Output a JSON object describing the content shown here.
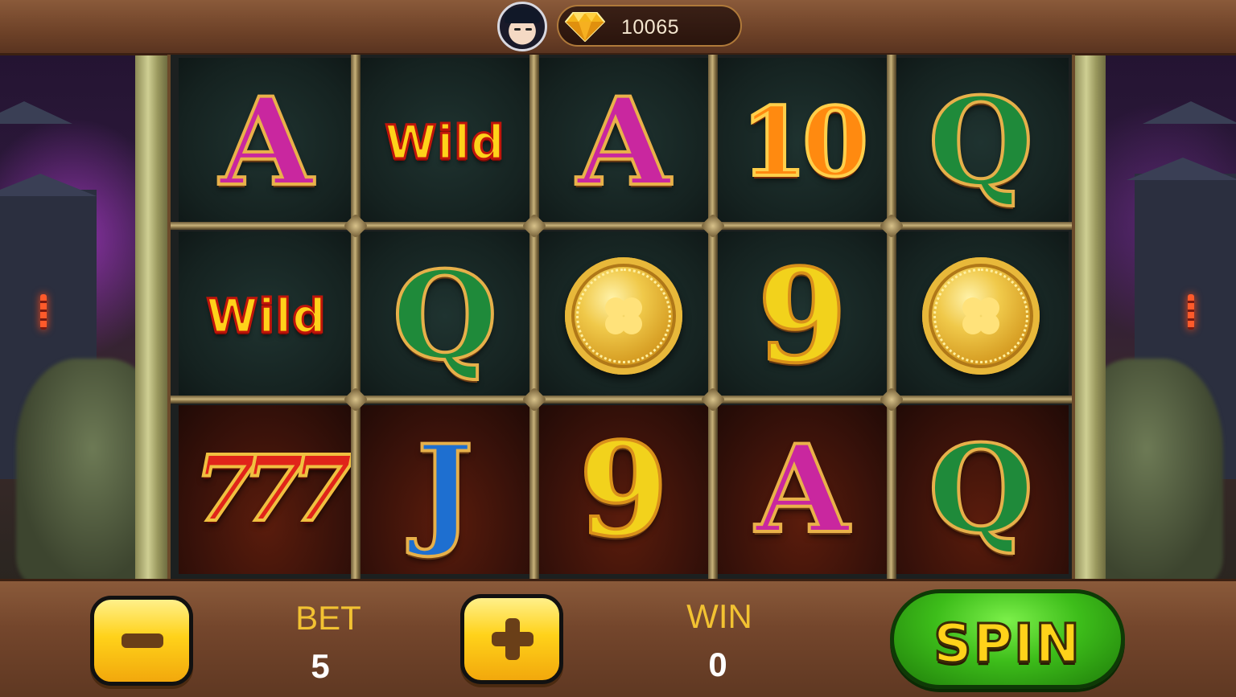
{
  "header": {
    "balance": "10065",
    "currency_icon": "diamond-icon",
    "avatar": "player-avatar"
  },
  "reels": {
    "rows": [
      [
        "A",
        "Wild",
        "A",
        "10",
        "Q"
      ],
      [
        "Wild",
        "Q",
        "coin",
        "9",
        "coin"
      ],
      [
        "777",
        "J",
        "9",
        "A",
        "Q"
      ]
    ]
  },
  "controls": {
    "bet_label": "BET",
    "bet_value": "5",
    "win_label": "WIN",
    "win_value": "0",
    "spin_label": "SPIN"
  },
  "colors": {
    "bar_brown": "#74462c",
    "gold": "#ffd21a",
    "spin_green": "#3dbd1a",
    "label_yellow": "#f2c232"
  }
}
